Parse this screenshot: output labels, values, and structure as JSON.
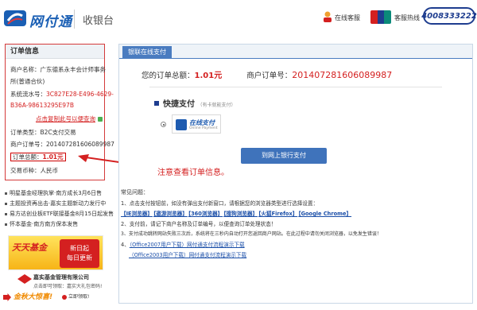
{
  "header": {
    "logo_text": "网付通",
    "subtitle": "收银台",
    "customer_service": "在线客服",
    "hotline_label": "客服热线",
    "hotline_number": "4008333222"
  },
  "order_info": {
    "title": "订单信息",
    "merchant_label": "商户名称：",
    "merchant_name_l1": "广东德系永丰会计师事务",
    "merchant_name_l2": "所(普通合伙)",
    "serial_label": "系统流水号：",
    "serial_l1": "3C827E28-E496-4629-",
    "serial_l2": "B36A-98613295E97B",
    "copy_link": "点击复制此号以便查询",
    "type_line": "订单类型：B2C支付交易",
    "order_no_line": "商户订单号：201407281606089987",
    "total_label": "订单总额：",
    "total_value": "1.01元",
    "currency_line": "交易币种：人民币"
  },
  "left_news": [
    "明星基金经理执掌·南方成长3月6日售",
    "主题投资再出击·嘉实主题新动力发行中",
    "易方达创业板ETF联接基金8月15日起发售",
    "怀本基金·南方南方保本发售"
  ],
  "ad": {
    "headline": "天天基金",
    "badge_l1": "新日起",
    "badge_l2": "每日更新",
    "company": "嘉实基金管理有限公司",
    "slogan": "点击即可领取：嘉实大礼包密码!",
    "promo_text": "金秋大惊喜!",
    "promo_button": "立即领取!"
  },
  "main": {
    "tab": "银联在线支付",
    "amount_label": "您的订单总额：",
    "amount_value": "1.01元",
    "order_no_label": "商户订单号：",
    "order_no_value": "201407281606089987",
    "quick_pay": "快捷支付",
    "quick_pay_sub": "（有卡就能支付）",
    "online_pay": "在线支付",
    "online_pay_sub": "Online Payment",
    "pay_button": "到网上银行支付",
    "notice": "注意查看订单信息。"
  },
  "faq": {
    "title": "常见问题：",
    "q1": "1、点击支付按钮前，如没有弹出支付新窗口，请根据您的浏览器类型进行选择设置：",
    "browsers": [
      "【IE浏览器】",
      "【遨游浏览器】",
      "【360浏览器】",
      "【搜狗浏览器】",
      "【火狐Firefox】",
      "【Google Chrome】"
    ],
    "q2": "2、支付前，请记下商户名称及订单编号，以便查询订单处理状态！",
    "q3": "3、支付成功跳转网站失败三次后，系统将在三秒内自动打开您返回商户网站。在此过程中请勿关闭浏览器，以免发生错误！",
    "q4_prefix": "4、",
    "q4_link1": "（Office2007用户下载）网付通支付流程演示下载",
    "q4_link2": "（Office2003用户下载）网付通支付流程演示下载"
  },
  "colors": {
    "brand_blue": "#1a5fb4",
    "accent_red": "#d42020",
    "tab_blue": "#4a7cc0"
  }
}
